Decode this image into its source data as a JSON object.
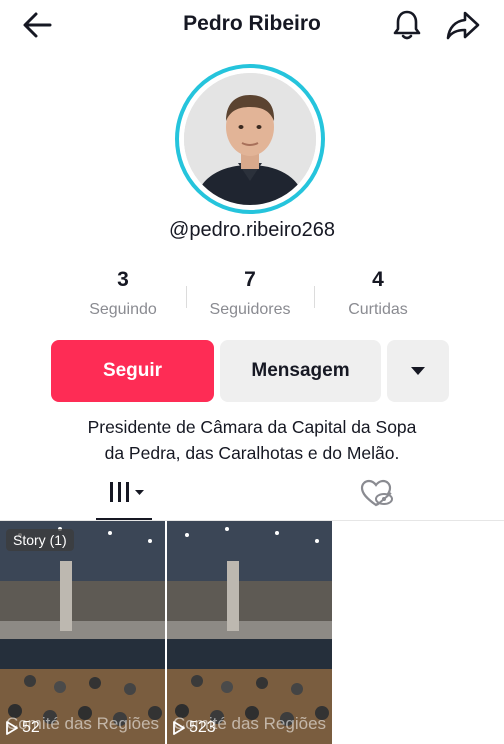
{
  "header": {
    "title": "Pedro Ribeiro",
    "back_icon": "arrow-left-icon",
    "bell_icon": "bell-icon",
    "share_icon": "share-arrow-icon"
  },
  "profile": {
    "handle": "@pedro.ribeiro268",
    "ring_color": "#25c4dc"
  },
  "stats": [
    {
      "value": "3",
      "label": "Seguindo"
    },
    {
      "value": "7",
      "label": "Seguidores"
    },
    {
      "value": "4",
      "label": "Curtidas"
    }
  ],
  "actions": {
    "follow_label": "Seguir",
    "message_label": "Mensagem",
    "more_icon": "caret-down-icon",
    "follow_color": "#fe2c55"
  },
  "bio": {
    "line1": "Presidente de Câmara da Capital da Sopa",
    "line2": "da Pedra, das Caralhotas e do Melão."
  },
  "tabs": {
    "videos_icon": "grid-bars-icon",
    "liked_icon": "hidden-heart-icon"
  },
  "videos": [
    {
      "badge": "Story (1)",
      "caption": "Comité das Regiões",
      "views": "52"
    },
    {
      "badge": "",
      "caption": "Comité das Regiões",
      "views": "523"
    }
  ]
}
